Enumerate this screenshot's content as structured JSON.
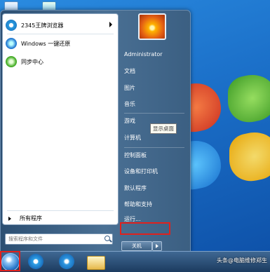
{
  "start_menu": {
    "programs": [
      {
        "label": "2345王牌浏览器",
        "icon": "browser-icon",
        "has_submenu": true
      },
      {
        "label": "Windows 一键还原",
        "icon": "restore-icon",
        "has_submenu": false
      },
      {
        "label": "同步中心",
        "icon": "sync-icon",
        "has_submenu": false
      }
    ],
    "all_programs_label": "所有程序",
    "search_placeholder": "搜索程序和文件",
    "right_items": {
      "user": "Administrator",
      "documents": "文档",
      "pictures": "图片",
      "music": "音乐",
      "games": "游戏",
      "computer": "计算机",
      "control_panel": "控制面板",
      "devices_printers": "设备和打印机",
      "default_programs": "默认程序",
      "help_support": "帮助和支持",
      "run": "运行..."
    },
    "shutdown_label": "关机",
    "tooltip": "显示桌面"
  },
  "taskbar": {
    "items": [
      "ie-icon",
      "media-player-icon",
      "file-explorer-icon"
    ]
  },
  "watermark": "头条@电脑维修郑生",
  "colors": {
    "highlight": "#e0211d",
    "taskbar": "#1c3b5f"
  }
}
